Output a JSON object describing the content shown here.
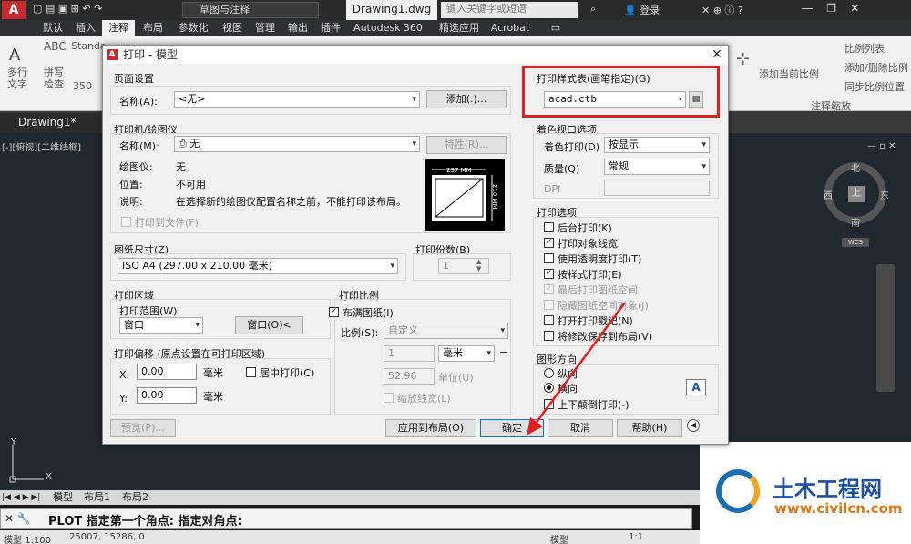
{
  "titlebar": {
    "workspace": "草图与注释",
    "document": "Drawing1.dwg",
    "search_placeholder": "键入关键字或短语",
    "login": "登录"
  },
  "ribbon_tabs": [
    "默认",
    "插入",
    "注释",
    "布局",
    "参数化",
    "视图",
    "管理",
    "输出",
    "插件",
    "Autodesk 360",
    "精选应用",
    "Acrobat"
  ],
  "ribbon": {
    "multiline_text": "多行\n文字",
    "spell_check": "拼写\n检查",
    "standard": "Standa",
    "size_350": "350",
    "scale_list": "比例列表",
    "add_current_scale": "添加当前比例",
    "add_delete_scale": "添加/删除比例",
    "sync_scale": "同步比例位置",
    "annotation_scaling": "注释缩放"
  },
  "doc_tab": "Drawing1*",
  "view_label": "[-][俯视][二维线框]",
  "viewcube": {
    "top": "上",
    "north": "北",
    "south": "南",
    "east": "东",
    "west": "西",
    "wcs": "WCS"
  },
  "layout_tabs": [
    "模型",
    "布局1",
    "布局2"
  ],
  "command_line": "PLOT 指定第一个角点: 指定对角点:",
  "status_bar": {
    "scale": "模型 1:100",
    "coords": "25007, 15286, 0",
    "model": "模型",
    "anno_scale": "1:1"
  },
  "watermark": {
    "title": "土木工程网",
    "url": "www.civilcn.com"
  },
  "dialog": {
    "title": "打印 - 模型",
    "page_setup": {
      "label": "页面设置",
      "name_label": "名称(A):",
      "name_value": "<无>",
      "add_button": "添加(.)..."
    },
    "printer": {
      "label": "打印机/绘图仪",
      "name_label": "名称(M):",
      "name_value": "无",
      "properties_button": "特性(R)...",
      "plotter_label": "绘图仪:",
      "plotter_value": "无",
      "location_label": "位置:",
      "location_value": "不可用",
      "description_label": "说明:",
      "description_value": "在选择新的绘图仪配置名称之前，不能打印该布局。",
      "print_to_file": "打印到文件(F)",
      "preview_width": "297 MM",
      "preview_height": "210 MM"
    },
    "paper_size": {
      "label": "图纸尺寸(Z)",
      "value": "ISO A4 (297.00 x 210.00 毫米)"
    },
    "copies": {
      "label": "打印份数(B)",
      "value": "1"
    },
    "plot_area": {
      "label": "打印区域",
      "range_label": "打印范围(W):",
      "range_value": "窗口",
      "window_button": "窗口(O)<"
    },
    "plot_offset": {
      "label": "打印偏移 (原点设置在可打印区域)",
      "x_label": "X:",
      "x_value": "0.00",
      "y_label": "Y:",
      "y_value": "0.00",
      "unit": "毫米",
      "center": "居中打印(C)"
    },
    "plot_scale": {
      "label": "打印比例",
      "fit_paper": "布满图纸(I)",
      "scale_label": "比例(S):",
      "scale_value": "自定义",
      "value1": "1",
      "unit1": "毫米",
      "value2": "52.96",
      "unit2": "单位(U)",
      "eq": "=",
      "scale_lineweights": "缩放线宽(L)"
    },
    "plot_style_table": {
      "label": "打印样式表(画笔指定)(G)",
      "value": "acad.ctb"
    },
    "shaded_viewport": {
      "label": "着色视口选项",
      "shade_label": "着色打印(D)",
      "shade_value": "按显示",
      "quality_label": "质量(Q)",
      "quality_value": "常规",
      "dpi_label": "DPI"
    },
    "plot_options": {
      "label": "打印选项",
      "items": [
        {
          "text": "后台打印(K)",
          "checked": false,
          "disabled": false
        },
        {
          "text": "打印对象线宽",
          "checked": true,
          "disabled": false
        },
        {
          "text": "使用透明度打印(T)",
          "checked": false,
          "disabled": false
        },
        {
          "text": "按样式打印(E)",
          "checked": true,
          "disabled": false
        },
        {
          "text": "最后打印图纸空间",
          "checked": true,
          "disabled": true
        },
        {
          "text": "隐藏图纸空间对象(J)",
          "checked": false,
          "disabled": true
        },
        {
          "text": "打开打印戳记(N)",
          "checked": false,
          "disabled": false
        },
        {
          "text": "将修改保存到布局(V)",
          "checked": false,
          "disabled": false
        }
      ]
    },
    "orientation": {
      "label": "图形方向",
      "portrait": "纵向",
      "landscape": "横向",
      "upside_down": "上下颠倒打印(-)",
      "icon_letter": "A"
    },
    "buttons": {
      "preview": "预览(P)...",
      "apply_layout": "应用到布局(O)",
      "ok": "确定",
      "cancel": "取消",
      "help": "帮助(H)"
    }
  },
  "colors": {
    "highlight": "#e02020",
    "accent": "#c8292b"
  }
}
